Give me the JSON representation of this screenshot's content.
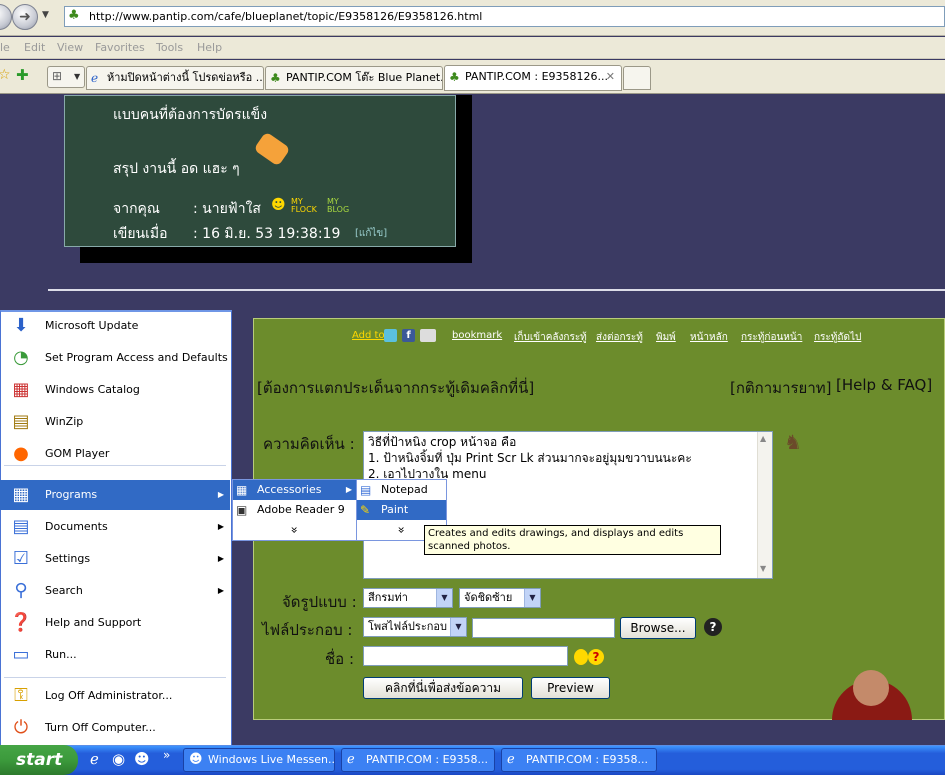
{
  "browser": {
    "url": "http://www.pantip.com/cafe/blueplanet/topic/E9358126/E9358126.html",
    "menus": [
      "le",
      "Edit",
      "View",
      "Favorites",
      "Tools",
      "Help"
    ],
    "tabs": [
      {
        "label": "ห้ามปิดหน้าต่างนี้ โปรดข่อหรือ ..."
      },
      {
        "label": "PANTIP.COM โต๊ะ Blue Planet..."
      },
      {
        "label": "PANTIP.COM : E9358126..."
      }
    ],
    "tab_close": "✕"
  },
  "post": {
    "line1": "แบบคนที่ต้องการบัดรแข็ง",
    "line2": "สรุป งานนี้ อด แฮะ ๆ",
    "from_label": "จากคุณ",
    "from_value": ": นายฟ้าใส",
    "my_flock": "MY FLOCK",
    "my_blog": "MY BLOG",
    "date_label": "เขียนเมื่อ",
    "date_value": ": 16 มิ.ย. 53 19:38:19",
    "edit_link": "[แก้ไข]"
  },
  "form": {
    "links": [
      "Add to",
      "bookmark",
      "เก็บเข้าคลังกระทู้",
      "ส่งต่อกระทู้",
      "พิมพ์",
      "หน้าหลัก",
      "กระทู้ก่อนหน้า",
      "กระทู้ถัดไป"
    ],
    "branch_link": "[ต้องการแตกประเด็นจากกระทู้เดิมคลิกที่นี่]",
    "rules_link": "[กติกามารยาท]",
    "help_link": "[Help & FAQ]",
    "comment_label": "ความคิดเห็น :",
    "comment_lines": [
      "วิธีที่ป้าหนิง crop หน้าจอ คือ",
      "1. ป้าหนิงจิ้มที่ ปุ่ม Print Scr Lk ส่วนมากจะอยู่มุมขวาบนนะคะ",
      "2. เอาไปวางใน menu"
    ],
    "format_label": "จัดรูปแบบ :",
    "color_select": "สีกรมท่า",
    "align_select": "จัดชิดซ้าย",
    "attach_label": "ไฟล์ประกอบ :",
    "attach_select": "โพสไฟล์ประกอบ",
    "browse_button": "Browse...",
    "name_label": "ชื่อ :",
    "submit_button": "คลิกที่นี่เพื่อส่งข้อความ",
    "preview_button": "Preview"
  },
  "start_menu": {
    "items": [
      {
        "label": "Microsoft Update"
      },
      {
        "label": "Set Program Access and Defaults"
      },
      {
        "label": "Windows Catalog"
      },
      {
        "label": "WinZip"
      },
      {
        "label": "GOM Player"
      },
      {
        "label": "Programs"
      },
      {
        "label": "Documents"
      },
      {
        "label": "Settings"
      },
      {
        "label": "Search"
      },
      {
        "label": "Help and Support"
      },
      {
        "label": "Run..."
      }
    ],
    "logoff": "Log Off Administrator...",
    "turnoff": "Turn Off Computer...",
    "programs_sub": [
      "Accessories",
      "Adobe Reader 9"
    ],
    "accessories_sub": [
      "Notepad",
      "Paint"
    ],
    "expand": "»",
    "tooltip": "Creates and edits drawings, and displays and edits scanned photos."
  },
  "taskbar": {
    "start_label": "start",
    "ql_more": "»",
    "buttons": [
      {
        "label": "Windows Live Messen..."
      },
      {
        "label": "PANTIP.COM : E9358..."
      },
      {
        "label": "PANTIP.COM : E9358..."
      }
    ]
  }
}
